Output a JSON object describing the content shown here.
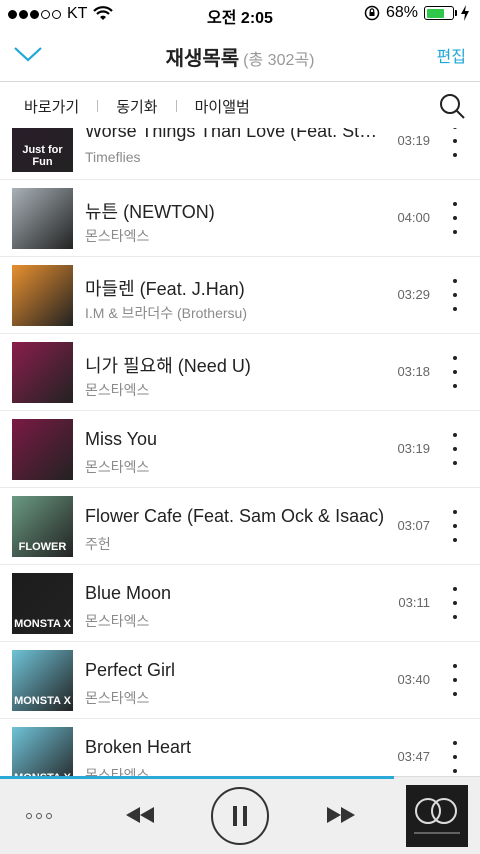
{
  "status": {
    "carrier": "KT",
    "time": "오전 2:05",
    "battery": "68%",
    "battery_level": 0.68,
    "signal_bars": 3
  },
  "header": {
    "title": "재생목록",
    "count": "(총 302곡)",
    "edit": "편집"
  },
  "nav": {
    "items": [
      {
        "label": "바로가기"
      },
      {
        "label": "동기화"
      },
      {
        "label": "마이앨범"
      }
    ]
  },
  "songs": [
    {
      "title": "Worse Things Than Love (Feat. Stephanie)",
      "artist": "Timeflies",
      "duration": "03:19",
      "cover_color": "#2a1c2a",
      "cover_text": "Just for Fun"
    },
    {
      "title": "뉴튼 (NEWTON)",
      "artist": "몬스타엑스",
      "duration": "04:00",
      "cover_color": "#a9b2b8",
      "cover_text": ""
    },
    {
      "title": "마들렌 (Feat. J.Han)",
      "artist": "I.M & 브라더수 (Brothersu)",
      "duration": "03:29",
      "cover_color": "#e8902f",
      "cover_text": ""
    },
    {
      "title": "니가 필요해 (Need U)",
      "artist": "몬스타엑스",
      "duration": "03:18",
      "cover_color": "#8a1e4c",
      "cover_text": ""
    },
    {
      "title": "Miss You",
      "artist": "몬스타엑스",
      "duration": "03:19",
      "cover_color": "#7b1a44",
      "cover_text": ""
    },
    {
      "title": "Flower Cafe (Feat. Sam Ock & Isaac)",
      "artist": "주헌",
      "duration": "03:07",
      "cover_color": "#6a9a82",
      "cover_text": "FLOWER"
    },
    {
      "title": "Blue Moon",
      "artist": "몬스타엑스",
      "duration": "03:11",
      "cover_color": "#1c1c1c",
      "cover_text": "MONSTA X"
    },
    {
      "title": "Perfect Girl",
      "artist": "몬스타엑스",
      "duration": "03:40",
      "cover_color": "#6fc3d8",
      "cover_text": "MONSTA X"
    },
    {
      "title": "Broken Heart",
      "artist": "몬스타엑스",
      "duration": "03:47",
      "cover_color": "#6fc3d8",
      "cover_text": "MONSTA X"
    }
  ],
  "player": {
    "progress": 0.82,
    "accent_color": "#2aa8d6",
    "icons": [
      "more-options-icon",
      "previous-icon",
      "pause-icon",
      "next-icon"
    ]
  },
  "colors": {
    "accent": "#1ea7d8",
    "text_primary": "#222222",
    "text_secondary": "#8a8a8a"
  }
}
